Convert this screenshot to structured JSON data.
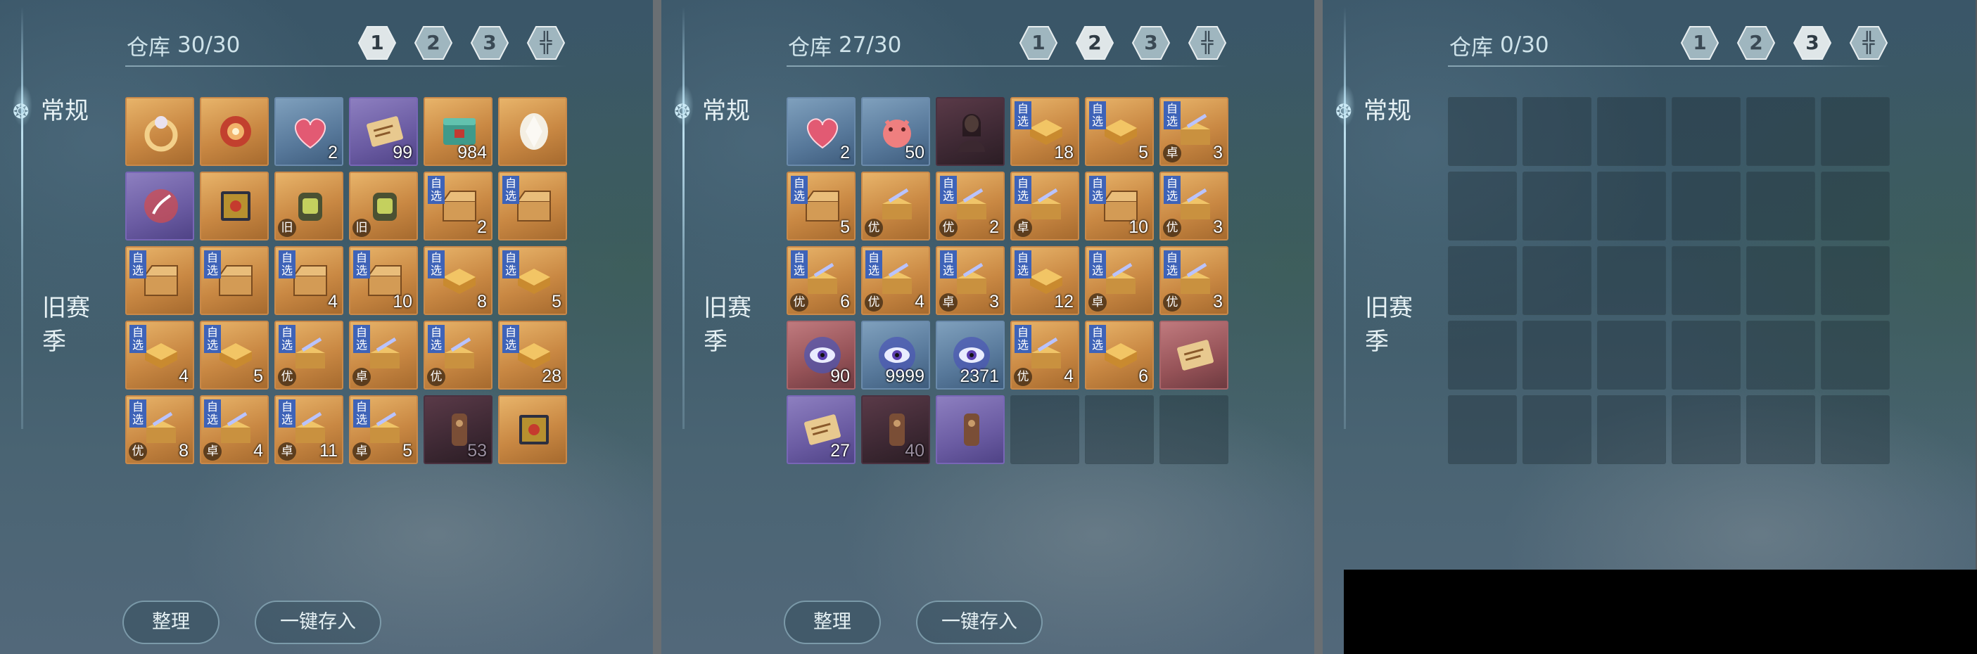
{
  "panels": [
    {
      "title": "仓库",
      "count": "30/30",
      "tabs": [
        {
          "label": "1",
          "active": true
        },
        {
          "label": "2",
          "active": false
        },
        {
          "label": "3",
          "active": false
        },
        {
          "label": "",
          "active": false
        }
      ],
      "categories": {
        "general": "常规",
        "old_season": "旧赛季"
      },
      "buttons": {
        "sort": "整理",
        "store_all": "一键存入"
      },
      "items": [
        {
          "rarity": "gold",
          "icon": "ring-icon",
          "qty": ""
        },
        {
          "rarity": "gold",
          "icon": "amulet-icon",
          "qty": ""
        },
        {
          "rarity": "blue",
          "icon": "heart-icon",
          "qty": "2"
        },
        {
          "rarity": "purple",
          "icon": "scroll-icon",
          "qty": "99"
        },
        {
          "rarity": "gold",
          "icon": "jade-box-icon",
          "qty": "984"
        },
        {
          "rarity": "gold",
          "icon": "crystal-icon",
          "qty": ""
        },
        {
          "rarity": "purple",
          "icon": "spirit-icon",
          "qty": ""
        },
        {
          "rarity": "gold",
          "icon": "book-icon",
          "qty": ""
        },
        {
          "rarity": "gold",
          "icon": "lantern-icon",
          "qty": "",
          "grade": "旧"
        },
        {
          "rarity": "gold",
          "icon": "lantern-icon",
          "qty": "",
          "grade": "旧"
        },
        {
          "rarity": "gold",
          "icon": "chest-icon",
          "qty": "2",
          "tag": "自选"
        },
        {
          "rarity": "gold",
          "icon": "chest-icon",
          "qty": "",
          "tag": "自选"
        },
        {
          "rarity": "gold",
          "icon": "chest-icon",
          "qty": "",
          "tag": "自选"
        },
        {
          "rarity": "gold",
          "icon": "chest-icon",
          "qty": "",
          "tag": "自选"
        },
        {
          "rarity": "gold",
          "icon": "chest-icon",
          "qty": "4",
          "tag": "自选"
        },
        {
          "rarity": "gold",
          "icon": "chest-icon",
          "qty": "10",
          "tag": "自选"
        },
        {
          "rarity": "gold",
          "icon": "gold-chest-icon",
          "qty": "8",
          "tag": "自选"
        },
        {
          "rarity": "gold",
          "icon": "gold-chest-icon",
          "qty": "5",
          "tag": "自选"
        },
        {
          "rarity": "gold",
          "icon": "gold-chest-icon",
          "qty": "4",
          "tag": "自选"
        },
        {
          "rarity": "gold",
          "icon": "gold-chest-icon",
          "qty": "5",
          "tag": "自选"
        },
        {
          "rarity": "gold",
          "icon": "weapon-chest-icon",
          "qty": "",
          "tag": "自选",
          "grade": "优"
        },
        {
          "rarity": "gold",
          "icon": "weapon-chest-icon",
          "qty": "",
          "tag": "自选",
          "grade": "卓"
        },
        {
          "rarity": "gold",
          "icon": "weapon-chest-icon",
          "qty": "",
          "tag": "自选",
          "grade": "优"
        },
        {
          "rarity": "gold",
          "icon": "gold-chest-icon",
          "qty": "28",
          "tag": "自选"
        },
        {
          "rarity": "gold",
          "icon": "weapon-chest-icon",
          "qty": "8",
          "tag": "自选",
          "grade": "优"
        },
        {
          "rarity": "gold",
          "icon": "weapon-chest-icon",
          "qty": "4",
          "tag": "自选",
          "grade": "卓"
        },
        {
          "rarity": "gold",
          "icon": "weapon-chest-icon",
          "qty": "11",
          "tag": "自选",
          "grade": "卓"
        },
        {
          "rarity": "gold",
          "icon": "weapon-chest-icon",
          "qty": "5",
          "tag": "自选",
          "grade": "卓"
        },
        {
          "rarity": "dark",
          "icon": "token-icon",
          "qty": "53",
          "dim": true
        },
        {
          "rarity": "gold",
          "icon": "book-icon",
          "qty": ""
        }
      ]
    },
    {
      "title": "仓库",
      "count": "27/30",
      "tabs": [
        {
          "label": "1",
          "active": false
        },
        {
          "label": "2",
          "active": true
        },
        {
          "label": "3",
          "active": false
        },
        {
          "label": "",
          "active": false
        }
      ],
      "categories": {
        "general": "常规",
        "old_season": "旧赛季"
      },
      "buttons": {
        "sort": "整理",
        "store_all": "一键存入"
      },
      "items": [
        {
          "rarity": "blue",
          "icon": "heart-icon",
          "qty": "2"
        },
        {
          "rarity": "blue",
          "icon": "pig-icon",
          "qty": "50"
        },
        {
          "rarity": "dark",
          "icon": "character-icon",
          "qty": ""
        },
        {
          "rarity": "gold",
          "icon": "gold-chest-icon",
          "qty": "18",
          "tag": "自选"
        },
        {
          "rarity": "gold",
          "icon": "gold-chest-icon",
          "qty": "5",
          "tag": "自选"
        },
        {
          "rarity": "gold",
          "icon": "weapon-chest-icon",
          "qty": "3",
          "tag": "自选",
          "grade": "卓"
        },
        {
          "rarity": "gold",
          "icon": "chest-icon",
          "qty": "5",
          "tag": "自选"
        },
        {
          "rarity": "gold",
          "icon": "weapon-chest-icon",
          "qty": "",
          "grade": "优"
        },
        {
          "rarity": "gold",
          "icon": "weapon-chest-icon",
          "qty": "2",
          "tag": "自选",
          "grade": "优"
        },
        {
          "rarity": "gold",
          "icon": "weapon-chest-icon",
          "qty": "",
          "tag": "自选",
          "grade": "卓"
        },
        {
          "rarity": "gold",
          "icon": "chest-icon",
          "qty": "10",
          "tag": "自选"
        },
        {
          "rarity": "gold",
          "icon": "weapon-chest-icon",
          "qty": "3",
          "tag": "自选",
          "grade": "优"
        },
        {
          "rarity": "gold",
          "icon": "weapon-chest-icon",
          "qty": "6",
          "tag": "自选",
          "grade": "优"
        },
        {
          "rarity": "gold",
          "icon": "weapon-chest-icon",
          "qty": "4",
          "tag": "自选",
          "grade": "优"
        },
        {
          "rarity": "gold",
          "icon": "weapon-chest-icon",
          "qty": "3",
          "tag": "自选",
          "grade": "卓"
        },
        {
          "rarity": "gold",
          "icon": "gold-chest-icon",
          "qty": "12",
          "tag": "自选"
        },
        {
          "rarity": "gold",
          "icon": "weapon-chest-icon",
          "qty": "",
          "tag": "自选",
          "grade": "卓"
        },
        {
          "rarity": "gold",
          "icon": "weapon-chest-icon",
          "qty": "3",
          "tag": "自选",
          "grade": "优"
        },
        {
          "rarity": "red",
          "icon": "eye-orb-icon",
          "qty": "90"
        },
        {
          "rarity": "blue",
          "icon": "eye-orb-icon",
          "qty": "9999"
        },
        {
          "rarity": "blue",
          "icon": "eye-orb-icon",
          "qty": "2371"
        },
        {
          "rarity": "gold",
          "icon": "weapon-chest-icon",
          "qty": "4",
          "tag": "自选",
          "grade": "优"
        },
        {
          "rarity": "gold",
          "icon": "gold-chest-icon",
          "qty": "6",
          "tag": "自选"
        },
        {
          "rarity": "red",
          "icon": "scroll-icon",
          "qty": ""
        },
        {
          "rarity": "purple",
          "icon": "scroll-icon",
          "qty": "27"
        },
        {
          "rarity": "dark",
          "icon": "token-icon",
          "qty": "40",
          "dim": true
        },
        {
          "rarity": "purple",
          "icon": "token-icon",
          "qty": ""
        },
        {
          "rarity": "empty"
        },
        {
          "rarity": "empty"
        },
        {
          "rarity": "empty"
        }
      ]
    },
    {
      "title": "仓库",
      "count": "0/30",
      "tabs": [
        {
          "label": "1",
          "active": false
        },
        {
          "label": "2",
          "active": false
        },
        {
          "label": "3",
          "active": true
        },
        {
          "label": "",
          "active": false
        }
      ],
      "categories": {
        "general": "常规",
        "old_season": "旧赛季"
      },
      "buttons": {
        "sort": "",
        "store_all": ""
      },
      "items": [
        {
          "rarity": "empty"
        },
        {
          "rarity": "empty"
        },
        {
          "rarity": "empty"
        },
        {
          "rarity": "empty"
        },
        {
          "rarity": "empty"
        },
        {
          "rarity": "empty"
        },
        {
          "rarity": "empty"
        },
        {
          "rarity": "empty"
        },
        {
          "rarity": "empty"
        },
        {
          "rarity": "empty"
        },
        {
          "rarity": "empty"
        },
        {
          "rarity": "empty"
        },
        {
          "rarity": "empty"
        },
        {
          "rarity": "empty"
        },
        {
          "rarity": "empty"
        },
        {
          "rarity": "empty"
        },
        {
          "rarity": "empty"
        },
        {
          "rarity": "empty"
        },
        {
          "rarity": "empty"
        },
        {
          "rarity": "empty"
        },
        {
          "rarity": "empty"
        },
        {
          "rarity": "empty"
        },
        {
          "rarity": "empty"
        },
        {
          "rarity": "empty"
        },
        {
          "rarity": "empty"
        },
        {
          "rarity": "empty"
        },
        {
          "rarity": "empty"
        },
        {
          "rarity": "empty"
        },
        {
          "rarity": "empty"
        },
        {
          "rarity": "empty"
        }
      ]
    }
  ],
  "colors": {
    "tag": "#3e63b8",
    "gold_slot": "#c98843",
    "purple_slot": "#6a5ba2",
    "blue_slot": "#57789a",
    "red_slot": "#955257"
  }
}
